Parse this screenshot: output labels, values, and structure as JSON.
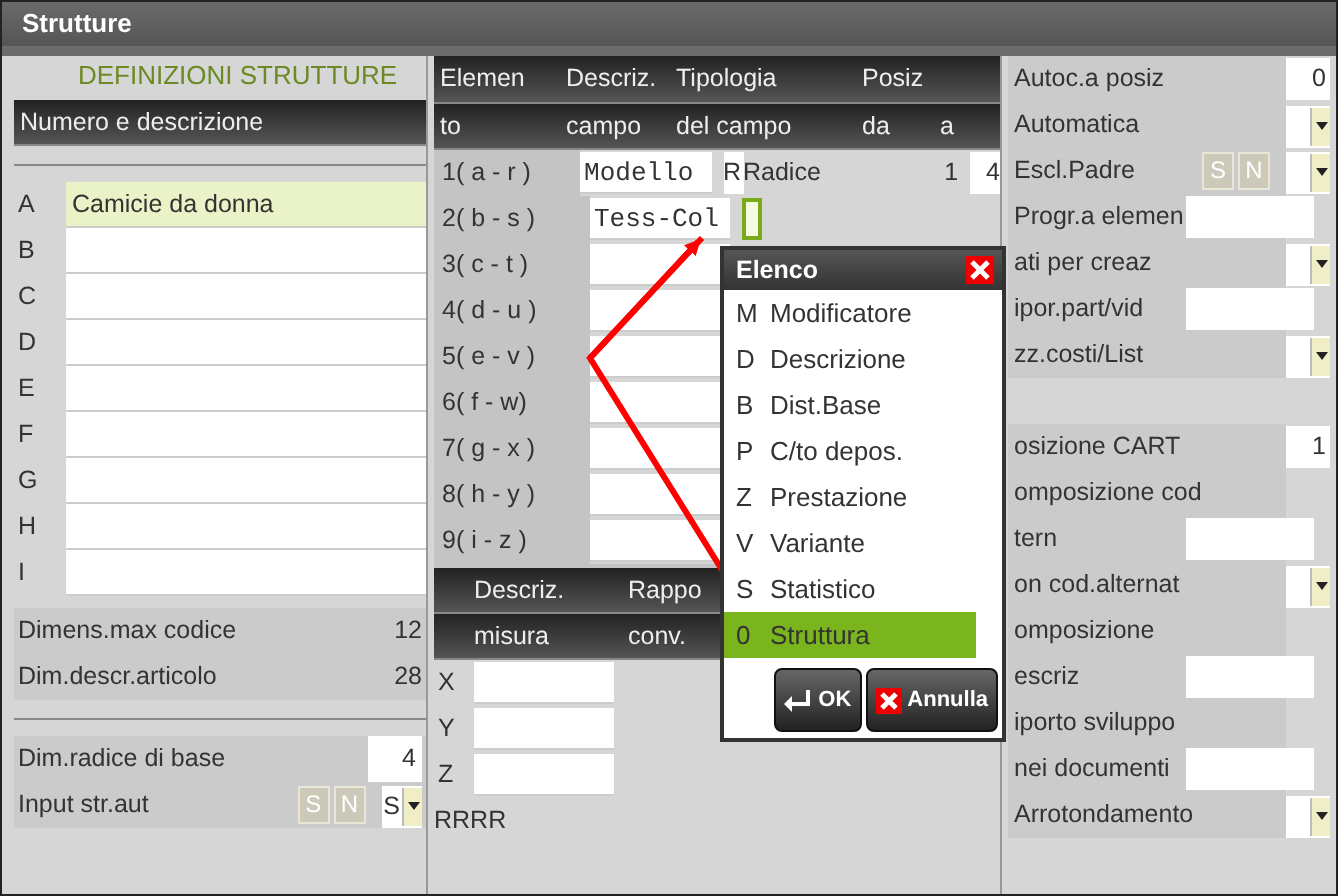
{
  "window": {
    "title": "Strutture"
  },
  "left_panel": {
    "heading": "DEFINIZIONI STRUTTURE",
    "header": "Numero e descrizione",
    "rows": [
      {
        "letter": "A",
        "value": "Camicie da donna",
        "selected": true
      },
      {
        "letter": "B",
        "selected": false
      },
      {
        "letter": "C",
        "selected": false
      },
      {
        "letter": "D",
        "selected": false
      },
      {
        "letter": "E",
        "selected": false
      },
      {
        "letter": "F",
        "selected": false
      },
      {
        "letter": "G",
        "selected": false
      },
      {
        "letter": "H",
        "selected": false
      },
      {
        "letter": "I",
        "selected": false
      }
    ],
    "sizes": [
      {
        "label": "Dimens.max codice",
        "value": "12"
      },
      {
        "label": "Dim.descr.articolo",
        "value": "28"
      }
    ],
    "base_root": {
      "label": "Dim.radice di base",
      "value": "4"
    },
    "auto_input": {
      "label": "Input str.aut",
      "options": [
        "S",
        "N"
      ],
      "value": "S"
    }
  },
  "elements": {
    "header_top": [
      "Elemen",
      "Descriz.",
      "Tipologia",
      "Posiz"
    ],
    "header_bottom": [
      "to",
      "campo",
      "del campo",
      "da",
      "a"
    ],
    "rows": [
      {
        "label": "1( a - r )",
        "description": "Modello",
        "type_code": "R",
        "type_name": "Radice",
        "from": "1",
        "to": "4",
        "focused": false
      },
      {
        "label": "2( b - s )",
        "description": "Tess-Col",
        "focused": true
      },
      {
        "label": "3( c - t )",
        "focused": false
      },
      {
        "label": "4( d - u )",
        "focused": false
      },
      {
        "label": "5( e - v )",
        "focused": false
      },
      {
        "label": "6( f  - w)",
        "focused": false
      },
      {
        "label": "7( g - x )",
        "focused": false
      },
      {
        "label": "8( h - y )",
        "focused": false
      },
      {
        "label": "9( i  - z )",
        "focused": false
      }
    ]
  },
  "measures": {
    "header_top": [
      "Descriz.",
      "Rappo"
    ],
    "header_bottom": [
      "misura",
      "conv."
    ],
    "rows": [
      {
        "label": "X"
      },
      {
        "label": "Y"
      },
      {
        "label": "Z"
      }
    ],
    "footer": "RRRR"
  },
  "right_panel": [
    {
      "kind": "value",
      "label": "Autoc.a posiz",
      "value": "0"
    },
    {
      "kind": "dropdown",
      "label": "Automatica"
    },
    {
      "kind": "choice",
      "label": "Escl.Padre",
      "options": [
        "S",
        "N"
      ]
    },
    {
      "kind": "input",
      "label": "Progr.a elemen"
    },
    {
      "kind": "dropdown",
      "label": "ati per creaz"
    },
    {
      "kind": "input",
      "label": "ipor.part/vid"
    },
    {
      "kind": "dropdown",
      "label": "zz.costi/List"
    },
    {
      "kind": "blank"
    },
    {
      "kind": "value",
      "label": "osizione CART",
      "value": "1"
    },
    {
      "kind": "text",
      "label": "omposizione cod"
    },
    {
      "kind": "input",
      "label": "tern"
    },
    {
      "kind": "dropdown",
      "label": "on cod.alternat"
    },
    {
      "kind": "text",
      "label": "omposizione"
    },
    {
      "kind": "input",
      "label": "escriz"
    },
    {
      "kind": "text",
      "label": "iporto sviluppo"
    },
    {
      "kind": "input",
      "label": "nei documenti"
    },
    {
      "kind": "dropdown",
      "label": "Arrotondamento"
    }
  ],
  "popup": {
    "title": "Elenco",
    "items": [
      {
        "code": "M",
        "label": "Modificatore",
        "selected": false
      },
      {
        "code": "D",
        "label": "Descrizione",
        "selected": false
      },
      {
        "code": "B",
        "label": "Dist.Base",
        "selected": false
      },
      {
        "code": "P",
        "label": "C/to depos.",
        "selected": false
      },
      {
        "code": "Z",
        "label": "Prestazione",
        "selected": false
      },
      {
        "code": "V",
        "label": "Variante",
        "selected": false
      },
      {
        "code": "S",
        "label": "Statistico",
        "selected": false
      },
      {
        "code": "0",
        "label": "Struttura",
        "selected": true
      }
    ],
    "buttons": [
      {
        "kind": "ok",
        "label": "OK"
      },
      {
        "kind": "cancel",
        "label": "Annulla"
      }
    ]
  }
}
